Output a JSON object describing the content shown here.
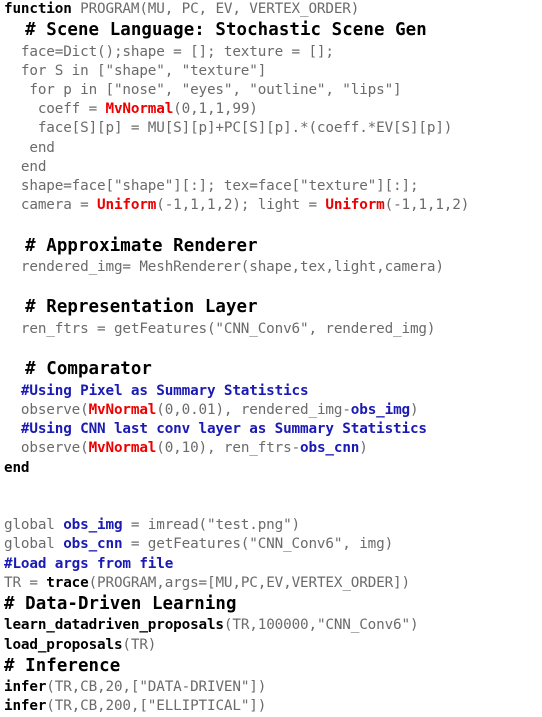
{
  "document": {
    "kind": "source-code-listing",
    "language": "probabilistic-program",
    "colors": {
      "background": "#ffffff",
      "plain_text": "#6b6b6b",
      "keyword": "#000000",
      "distribution": "#ee0000",
      "comment_blue": "#1a1ab4",
      "identifier_blue": "#1a1ab4",
      "heading": "#000000"
    }
  },
  "lines": [
    {
      "id": "l1",
      "type": "code",
      "tokens": [
        {
          "text": "function ",
          "style": "kw"
        },
        {
          "text": "PROGRAM(MU, PC, EV, VERTEX_ORDER)",
          "style": "plain"
        }
      ]
    },
    {
      "id": "l2",
      "type": "heading",
      "tokens": [
        {
          "text": "  # Scene Language: Stochastic Scene Gen",
          "style": "kw"
        }
      ]
    },
    {
      "id": "l3",
      "type": "code",
      "tokens": [
        {
          "text": "  face=Dict();shape = []; texture = [];",
          "style": "plain"
        }
      ]
    },
    {
      "id": "l4",
      "type": "code",
      "tokens": [
        {
          "text": "  for S in [\"shape\", \"texture\"]",
          "style": "plain"
        }
      ]
    },
    {
      "id": "l5",
      "type": "code",
      "tokens": [
        {
          "text": "   for p in [\"nose\", \"eyes\", \"outline\", \"lips\"]",
          "style": "plain"
        }
      ]
    },
    {
      "id": "l6",
      "type": "code",
      "tokens": [
        {
          "text": "    coeff = ",
          "style": "plain"
        },
        {
          "text": "MvNormal",
          "style": "dist"
        },
        {
          "text": "(0,1,1,99)",
          "style": "plain"
        }
      ]
    },
    {
      "id": "l7",
      "type": "code",
      "tokens": [
        {
          "text": "    face[S][p] = MU[S][p]+PC[S][p].*(coeff.*EV[S][p])",
          "style": "plain"
        }
      ]
    },
    {
      "id": "l8",
      "type": "code",
      "tokens": [
        {
          "text": "   end",
          "style": "plain"
        }
      ]
    },
    {
      "id": "l9",
      "type": "code",
      "tokens": [
        {
          "text": "  end",
          "style": "plain"
        }
      ]
    },
    {
      "id": "l10",
      "type": "code",
      "tokens": [
        {
          "text": "  shape=face[\"shape\"][:]; tex=face[\"texture\"][:];",
          "style": "plain"
        }
      ]
    },
    {
      "id": "l11",
      "type": "code",
      "tokens": [
        {
          "text": "  camera = ",
          "style": "plain"
        },
        {
          "text": "Uniform",
          "style": "dist"
        },
        {
          "text": "(-1,1,1,2); light = ",
          "style": "plain"
        },
        {
          "text": "Uniform",
          "style": "dist"
        },
        {
          "text": "(-1,1,1,2)",
          "style": "plain"
        }
      ]
    },
    {
      "id": "l12",
      "type": "blank",
      "tokens": [
        {
          "text": " ",
          "style": "plain"
        }
      ]
    },
    {
      "id": "l13",
      "type": "heading",
      "tokens": [
        {
          "text": "  # Approximate Renderer",
          "style": "kw"
        }
      ]
    },
    {
      "id": "l14",
      "type": "code",
      "tokens": [
        {
          "text": "  rendered_img= MeshRenderer(shape,tex,light,camera)",
          "style": "plain"
        }
      ]
    },
    {
      "id": "l15",
      "type": "blank",
      "tokens": [
        {
          "text": " ",
          "style": "plain"
        }
      ]
    },
    {
      "id": "l16",
      "type": "heading",
      "tokens": [
        {
          "text": "  # Representation Layer",
          "style": "kw"
        }
      ]
    },
    {
      "id": "l17",
      "type": "code",
      "tokens": [
        {
          "text": "  ren_ftrs = getFeatures(\"CNN_Conv6\", rendered_img)",
          "style": "plain"
        }
      ]
    },
    {
      "id": "l18",
      "type": "blank",
      "tokens": [
        {
          "text": " ",
          "style": "plain"
        }
      ]
    },
    {
      "id": "l19",
      "type": "heading",
      "tokens": [
        {
          "text": "  # Comparator",
          "style": "kw"
        }
      ]
    },
    {
      "id": "l20",
      "type": "code",
      "tokens": [
        {
          "text": "  #Using Pixel as Summary Statistics",
          "style": "comment"
        }
      ]
    },
    {
      "id": "l21",
      "type": "code",
      "tokens": [
        {
          "text": "  observe(",
          "style": "plain"
        },
        {
          "text": "MvNormal",
          "style": "dist"
        },
        {
          "text": "(0,0.01), rendered_img-",
          "style": "plain"
        },
        {
          "text": "obs_img",
          "style": "blue"
        },
        {
          "text": ")",
          "style": "plain"
        }
      ]
    },
    {
      "id": "l22",
      "type": "code",
      "tokens": [
        {
          "text": "  #Using CNN last conv layer as Summary Statistics",
          "style": "comment"
        }
      ]
    },
    {
      "id": "l23",
      "type": "code",
      "tokens": [
        {
          "text": "  observe(",
          "style": "plain"
        },
        {
          "text": "MvNormal",
          "style": "dist"
        },
        {
          "text": "(0,10), ren_ftrs-",
          "style": "plain"
        },
        {
          "text": "obs_cnn",
          "style": "blue"
        },
        {
          "text": ")",
          "style": "plain"
        }
      ]
    },
    {
      "id": "l24",
      "type": "code",
      "tokens": [
        {
          "text": "end",
          "style": "kw"
        }
      ]
    },
    {
      "id": "l25",
      "type": "blank",
      "tokens": [
        {
          "text": " ",
          "style": "plain"
        }
      ]
    },
    {
      "id": "l26",
      "type": "blank",
      "tokens": [
        {
          "text": " ",
          "style": "plain"
        }
      ]
    },
    {
      "id": "l27",
      "type": "code",
      "tokens": [
        {
          "text": "global ",
          "style": "plain"
        },
        {
          "text": "obs_img",
          "style": "blue"
        },
        {
          "text": " = imread(\"test.png\")",
          "style": "plain"
        }
      ]
    },
    {
      "id": "l28",
      "type": "code",
      "tokens": [
        {
          "text": "global ",
          "style": "plain"
        },
        {
          "text": "obs_cnn",
          "style": "blue"
        },
        {
          "text": " = getFeatures(\"CNN_Conv6\", img)",
          "style": "plain"
        }
      ]
    },
    {
      "id": "l29",
      "type": "code",
      "tokens": [
        {
          "text": "#Load args from file",
          "style": "comment"
        }
      ]
    },
    {
      "id": "l30",
      "type": "code",
      "tokens": [
        {
          "text": "TR = ",
          "style": "plain"
        },
        {
          "text": "trace",
          "style": "fn"
        },
        {
          "text": "(PROGRAM,args=[MU,PC,EV,VERTEX_ORDER])",
          "style": "plain"
        }
      ]
    },
    {
      "id": "l31",
      "type": "heading",
      "tokens": [
        {
          "text": "# Data-Driven Learning",
          "style": "kw"
        }
      ]
    },
    {
      "id": "l32",
      "type": "code",
      "tokens": [
        {
          "text": "learn_datadriven_proposals",
          "style": "fn"
        },
        {
          "text": "(TR,100000,\"CNN_Conv6\")",
          "style": "plain"
        }
      ]
    },
    {
      "id": "l33",
      "type": "code",
      "tokens": [
        {
          "text": "load_proposals",
          "style": "fn"
        },
        {
          "text": "(TR)",
          "style": "plain"
        }
      ]
    },
    {
      "id": "l34",
      "type": "heading",
      "tokens": [
        {
          "text": "# Inference",
          "style": "kw"
        }
      ]
    },
    {
      "id": "l35",
      "type": "code",
      "tokens": [
        {
          "text": "infer",
          "style": "fn"
        },
        {
          "text": "(TR,CB,20,[\"DATA-DRIVEN\"])",
          "style": "plain"
        }
      ]
    },
    {
      "id": "l36",
      "type": "code",
      "tokens": [
        {
          "text": "infer",
          "style": "fn"
        },
        {
          "text": "(TR,CB,200,[\"ELLIPTICAL\"])",
          "style": "plain"
        }
      ]
    }
  ]
}
